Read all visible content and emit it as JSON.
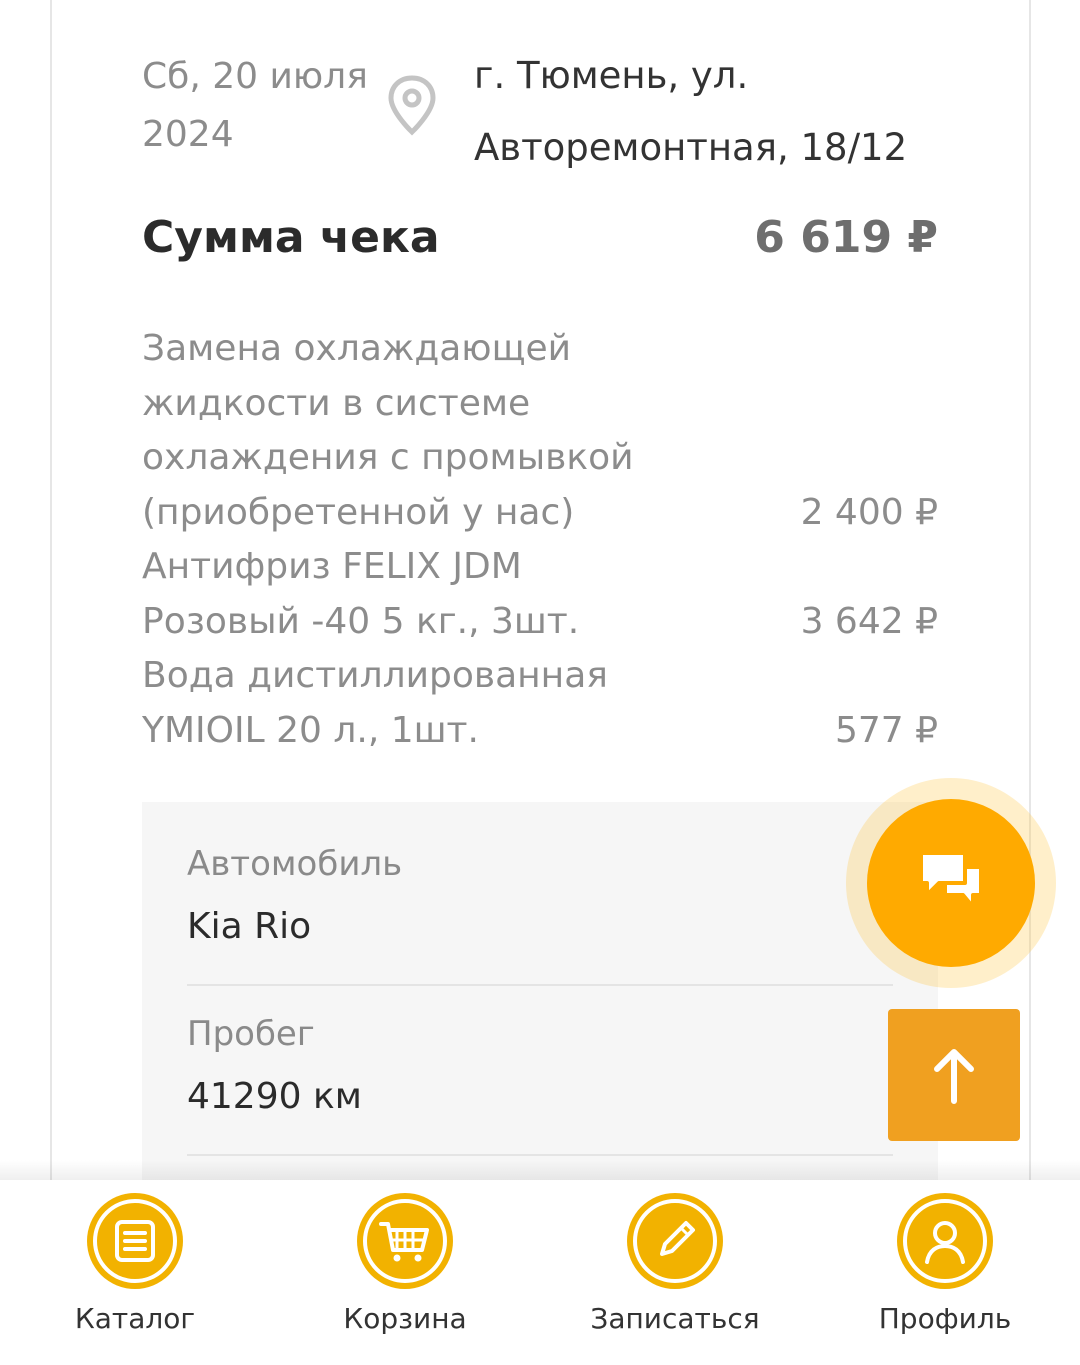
{
  "order": {
    "date_line1": "Сб, 20 июля",
    "date_line2": "2024",
    "address_line1": "г. Тюмень, ул.",
    "address_line2": "Авторемонтная, 18/12",
    "total_label": "Сумма чека",
    "total_value": "6 619 ₽"
  },
  "items": [
    {
      "name_lines": [
        "Замена охлаждающей",
        "жидкости в системе",
        "охлаждения с промывкой",
        "(приобретенной у нас)"
      ],
      "price": "2 400 ₽"
    },
    {
      "name_lines": [
        "Антифриз FELIX JDM",
        "Розовый -40 5 кг., 3шт."
      ],
      "price": "3 642 ₽"
    },
    {
      "name_lines": [
        "Вода дистиллированная",
        "YMIOIL 20 л., 1шт."
      ],
      "price": "577 ₽"
    }
  ],
  "details": {
    "car_label": "Автомобиль",
    "car_value": "Kia Rio",
    "mileage_label": "Пробег",
    "mileage_value": "41290 км"
  },
  "nav": {
    "items": [
      {
        "label": "Каталог",
        "icon": "catalog-icon"
      },
      {
        "label": "Корзина",
        "icon": "cart-icon"
      },
      {
        "label": "Записаться",
        "icon": "pencil-icon"
      },
      {
        "label": "Профиль",
        "icon": "profile-icon"
      }
    ]
  },
  "colors": {
    "accent": "#ffaa00",
    "scroll_button": "#f0a020",
    "nav_icon": "#f2b200"
  }
}
